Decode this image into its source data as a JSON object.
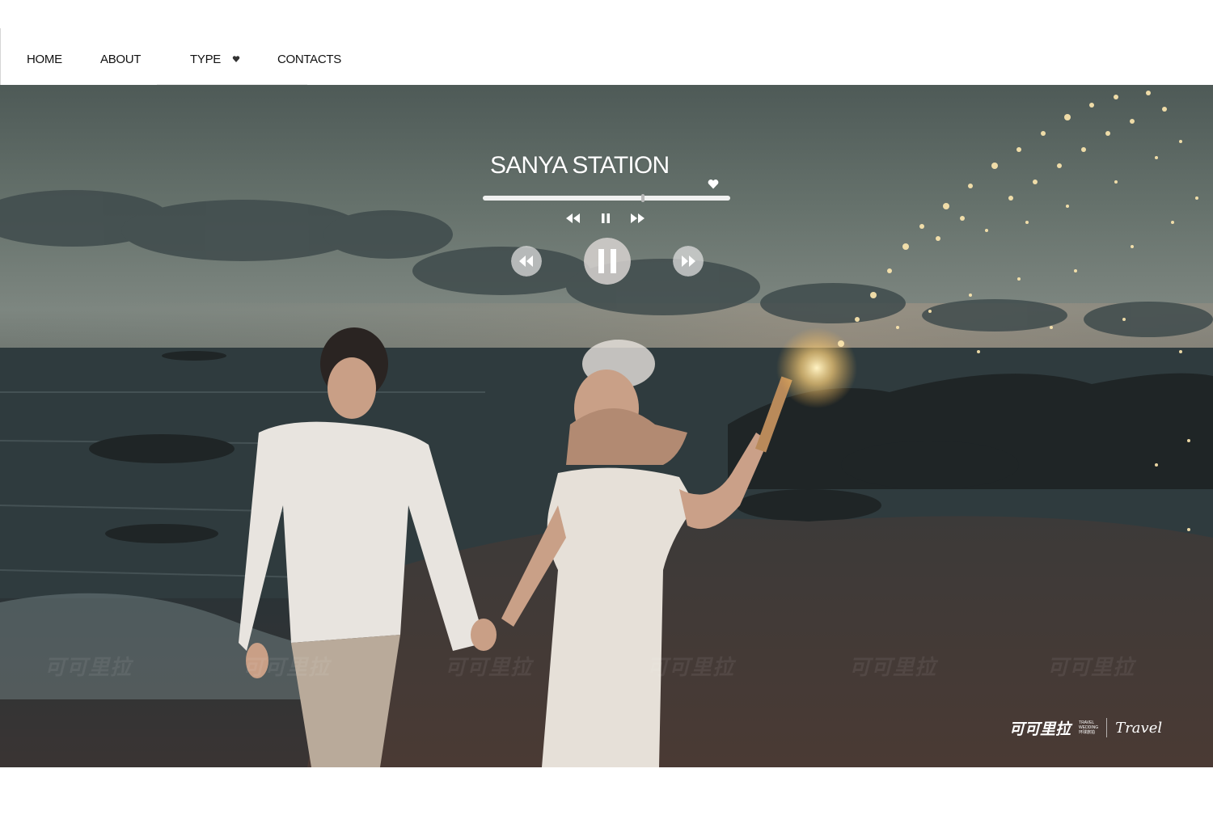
{
  "nav": {
    "items": [
      {
        "label": "HOME"
      },
      {
        "label": "ABOUT"
      },
      {
        "label": "TYPE"
      },
      {
        "label": "CONTACTS"
      }
    ],
    "type_dropdown_icon": "heart-caret-icon"
  },
  "player": {
    "title": "SANYA STATION",
    "progress": 0.65,
    "icons": {
      "favorite": "heart-icon",
      "small_prev": "rewind-icon",
      "small_pause": "pause-icon",
      "small_next": "fast-forward-icon",
      "big_prev": "rewind-circle-icon",
      "big_pause": "pause-circle-icon",
      "big_next": "fast-forward-circle-icon"
    }
  },
  "brand": {
    "name": "可可里拉",
    "sub_lines": [
      "TRAVEL",
      "WEDDING",
      "环球旅拍"
    ],
    "travel_mark": "Travel"
  },
  "watermark": "可可里拉",
  "colors": {
    "accent": "#ffffff",
    "nav_text": "#111111",
    "sky": "#66726c",
    "sea": "#2f3a3d"
  }
}
